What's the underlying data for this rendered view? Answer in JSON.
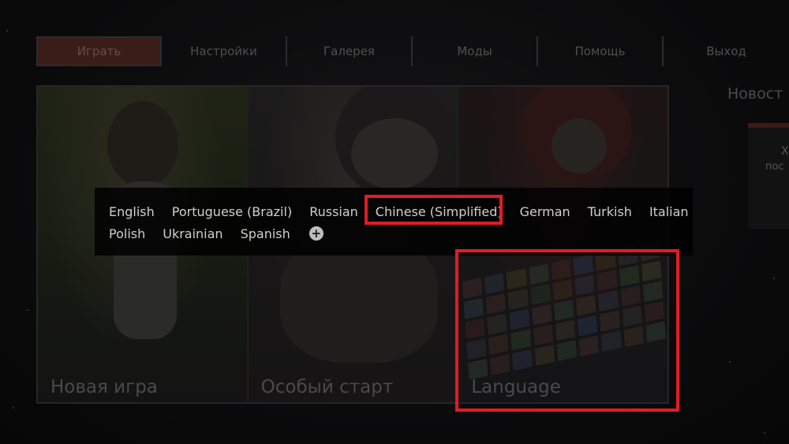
{
  "nav": {
    "tabs": [
      {
        "label": "Играть",
        "active": true
      },
      {
        "label": "Настройки",
        "active": false
      },
      {
        "label": "Галерея",
        "active": false
      },
      {
        "label": "Моды",
        "active": false
      },
      {
        "label": "Помощь",
        "active": false
      },
      {
        "label": "Выход",
        "active": false
      }
    ]
  },
  "tiles": {
    "new_game": "Новая игра",
    "special_start": "Особый старт",
    "language": "Language"
  },
  "news": {
    "title": "Новост",
    "card_line1": "Х",
    "card_line2": "пос"
  },
  "language_menu": {
    "row1": [
      "English",
      "Portuguese (Brazil)",
      "Russian",
      "Chinese (Simplified)",
      "German",
      "Turkish",
      "Italian"
    ],
    "row2": [
      "Polish",
      "Ukrainian",
      "Spanish"
    ],
    "add_symbol": "+",
    "highlighted": "Chinese (Simplified)"
  },
  "colors": {
    "highlight": "#e31b23",
    "active_tab": "#3a1c18",
    "text_dim": "#4f4f4f",
    "menu_text": "#cfcfcf"
  }
}
